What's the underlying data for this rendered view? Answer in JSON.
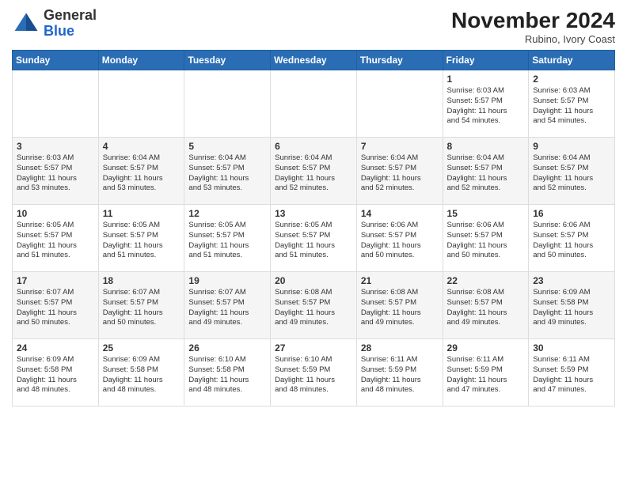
{
  "header": {
    "logo_line1": "General",
    "logo_line2": "Blue",
    "month_year": "November 2024",
    "location": "Rubino, Ivory Coast"
  },
  "weekdays": [
    "Sunday",
    "Monday",
    "Tuesday",
    "Wednesday",
    "Thursday",
    "Friday",
    "Saturday"
  ],
  "weeks": [
    [
      {
        "day": "",
        "info": ""
      },
      {
        "day": "",
        "info": ""
      },
      {
        "day": "",
        "info": ""
      },
      {
        "day": "",
        "info": ""
      },
      {
        "day": "",
        "info": ""
      },
      {
        "day": "1",
        "info": "Sunrise: 6:03 AM\nSunset: 5:57 PM\nDaylight: 11 hours\nand 54 minutes."
      },
      {
        "day": "2",
        "info": "Sunrise: 6:03 AM\nSunset: 5:57 PM\nDaylight: 11 hours\nand 54 minutes."
      }
    ],
    [
      {
        "day": "3",
        "info": "Sunrise: 6:03 AM\nSunset: 5:57 PM\nDaylight: 11 hours\nand 53 minutes."
      },
      {
        "day": "4",
        "info": "Sunrise: 6:04 AM\nSunset: 5:57 PM\nDaylight: 11 hours\nand 53 minutes."
      },
      {
        "day": "5",
        "info": "Sunrise: 6:04 AM\nSunset: 5:57 PM\nDaylight: 11 hours\nand 53 minutes."
      },
      {
        "day": "6",
        "info": "Sunrise: 6:04 AM\nSunset: 5:57 PM\nDaylight: 11 hours\nand 52 minutes."
      },
      {
        "day": "7",
        "info": "Sunrise: 6:04 AM\nSunset: 5:57 PM\nDaylight: 11 hours\nand 52 minutes."
      },
      {
        "day": "8",
        "info": "Sunrise: 6:04 AM\nSunset: 5:57 PM\nDaylight: 11 hours\nand 52 minutes."
      },
      {
        "day": "9",
        "info": "Sunrise: 6:04 AM\nSunset: 5:57 PM\nDaylight: 11 hours\nand 52 minutes."
      }
    ],
    [
      {
        "day": "10",
        "info": "Sunrise: 6:05 AM\nSunset: 5:57 PM\nDaylight: 11 hours\nand 51 minutes."
      },
      {
        "day": "11",
        "info": "Sunrise: 6:05 AM\nSunset: 5:57 PM\nDaylight: 11 hours\nand 51 minutes."
      },
      {
        "day": "12",
        "info": "Sunrise: 6:05 AM\nSunset: 5:57 PM\nDaylight: 11 hours\nand 51 minutes."
      },
      {
        "day": "13",
        "info": "Sunrise: 6:05 AM\nSunset: 5:57 PM\nDaylight: 11 hours\nand 51 minutes."
      },
      {
        "day": "14",
        "info": "Sunrise: 6:06 AM\nSunset: 5:57 PM\nDaylight: 11 hours\nand 50 minutes."
      },
      {
        "day": "15",
        "info": "Sunrise: 6:06 AM\nSunset: 5:57 PM\nDaylight: 11 hours\nand 50 minutes."
      },
      {
        "day": "16",
        "info": "Sunrise: 6:06 AM\nSunset: 5:57 PM\nDaylight: 11 hours\nand 50 minutes."
      }
    ],
    [
      {
        "day": "17",
        "info": "Sunrise: 6:07 AM\nSunset: 5:57 PM\nDaylight: 11 hours\nand 50 minutes."
      },
      {
        "day": "18",
        "info": "Sunrise: 6:07 AM\nSunset: 5:57 PM\nDaylight: 11 hours\nand 50 minutes."
      },
      {
        "day": "19",
        "info": "Sunrise: 6:07 AM\nSunset: 5:57 PM\nDaylight: 11 hours\nand 49 minutes."
      },
      {
        "day": "20",
        "info": "Sunrise: 6:08 AM\nSunset: 5:57 PM\nDaylight: 11 hours\nand 49 minutes."
      },
      {
        "day": "21",
        "info": "Sunrise: 6:08 AM\nSunset: 5:57 PM\nDaylight: 11 hours\nand 49 minutes."
      },
      {
        "day": "22",
        "info": "Sunrise: 6:08 AM\nSunset: 5:57 PM\nDaylight: 11 hours\nand 49 minutes."
      },
      {
        "day": "23",
        "info": "Sunrise: 6:09 AM\nSunset: 5:58 PM\nDaylight: 11 hours\nand 49 minutes."
      }
    ],
    [
      {
        "day": "24",
        "info": "Sunrise: 6:09 AM\nSunset: 5:58 PM\nDaylight: 11 hours\nand 48 minutes."
      },
      {
        "day": "25",
        "info": "Sunrise: 6:09 AM\nSunset: 5:58 PM\nDaylight: 11 hours\nand 48 minutes."
      },
      {
        "day": "26",
        "info": "Sunrise: 6:10 AM\nSunset: 5:58 PM\nDaylight: 11 hours\nand 48 minutes."
      },
      {
        "day": "27",
        "info": "Sunrise: 6:10 AM\nSunset: 5:59 PM\nDaylight: 11 hours\nand 48 minutes."
      },
      {
        "day": "28",
        "info": "Sunrise: 6:11 AM\nSunset: 5:59 PM\nDaylight: 11 hours\nand 48 minutes."
      },
      {
        "day": "29",
        "info": "Sunrise: 6:11 AM\nSunset: 5:59 PM\nDaylight: 11 hours\nand 47 minutes."
      },
      {
        "day": "30",
        "info": "Sunrise: 6:11 AM\nSunset: 5:59 PM\nDaylight: 11 hours\nand 47 minutes."
      }
    ]
  ]
}
